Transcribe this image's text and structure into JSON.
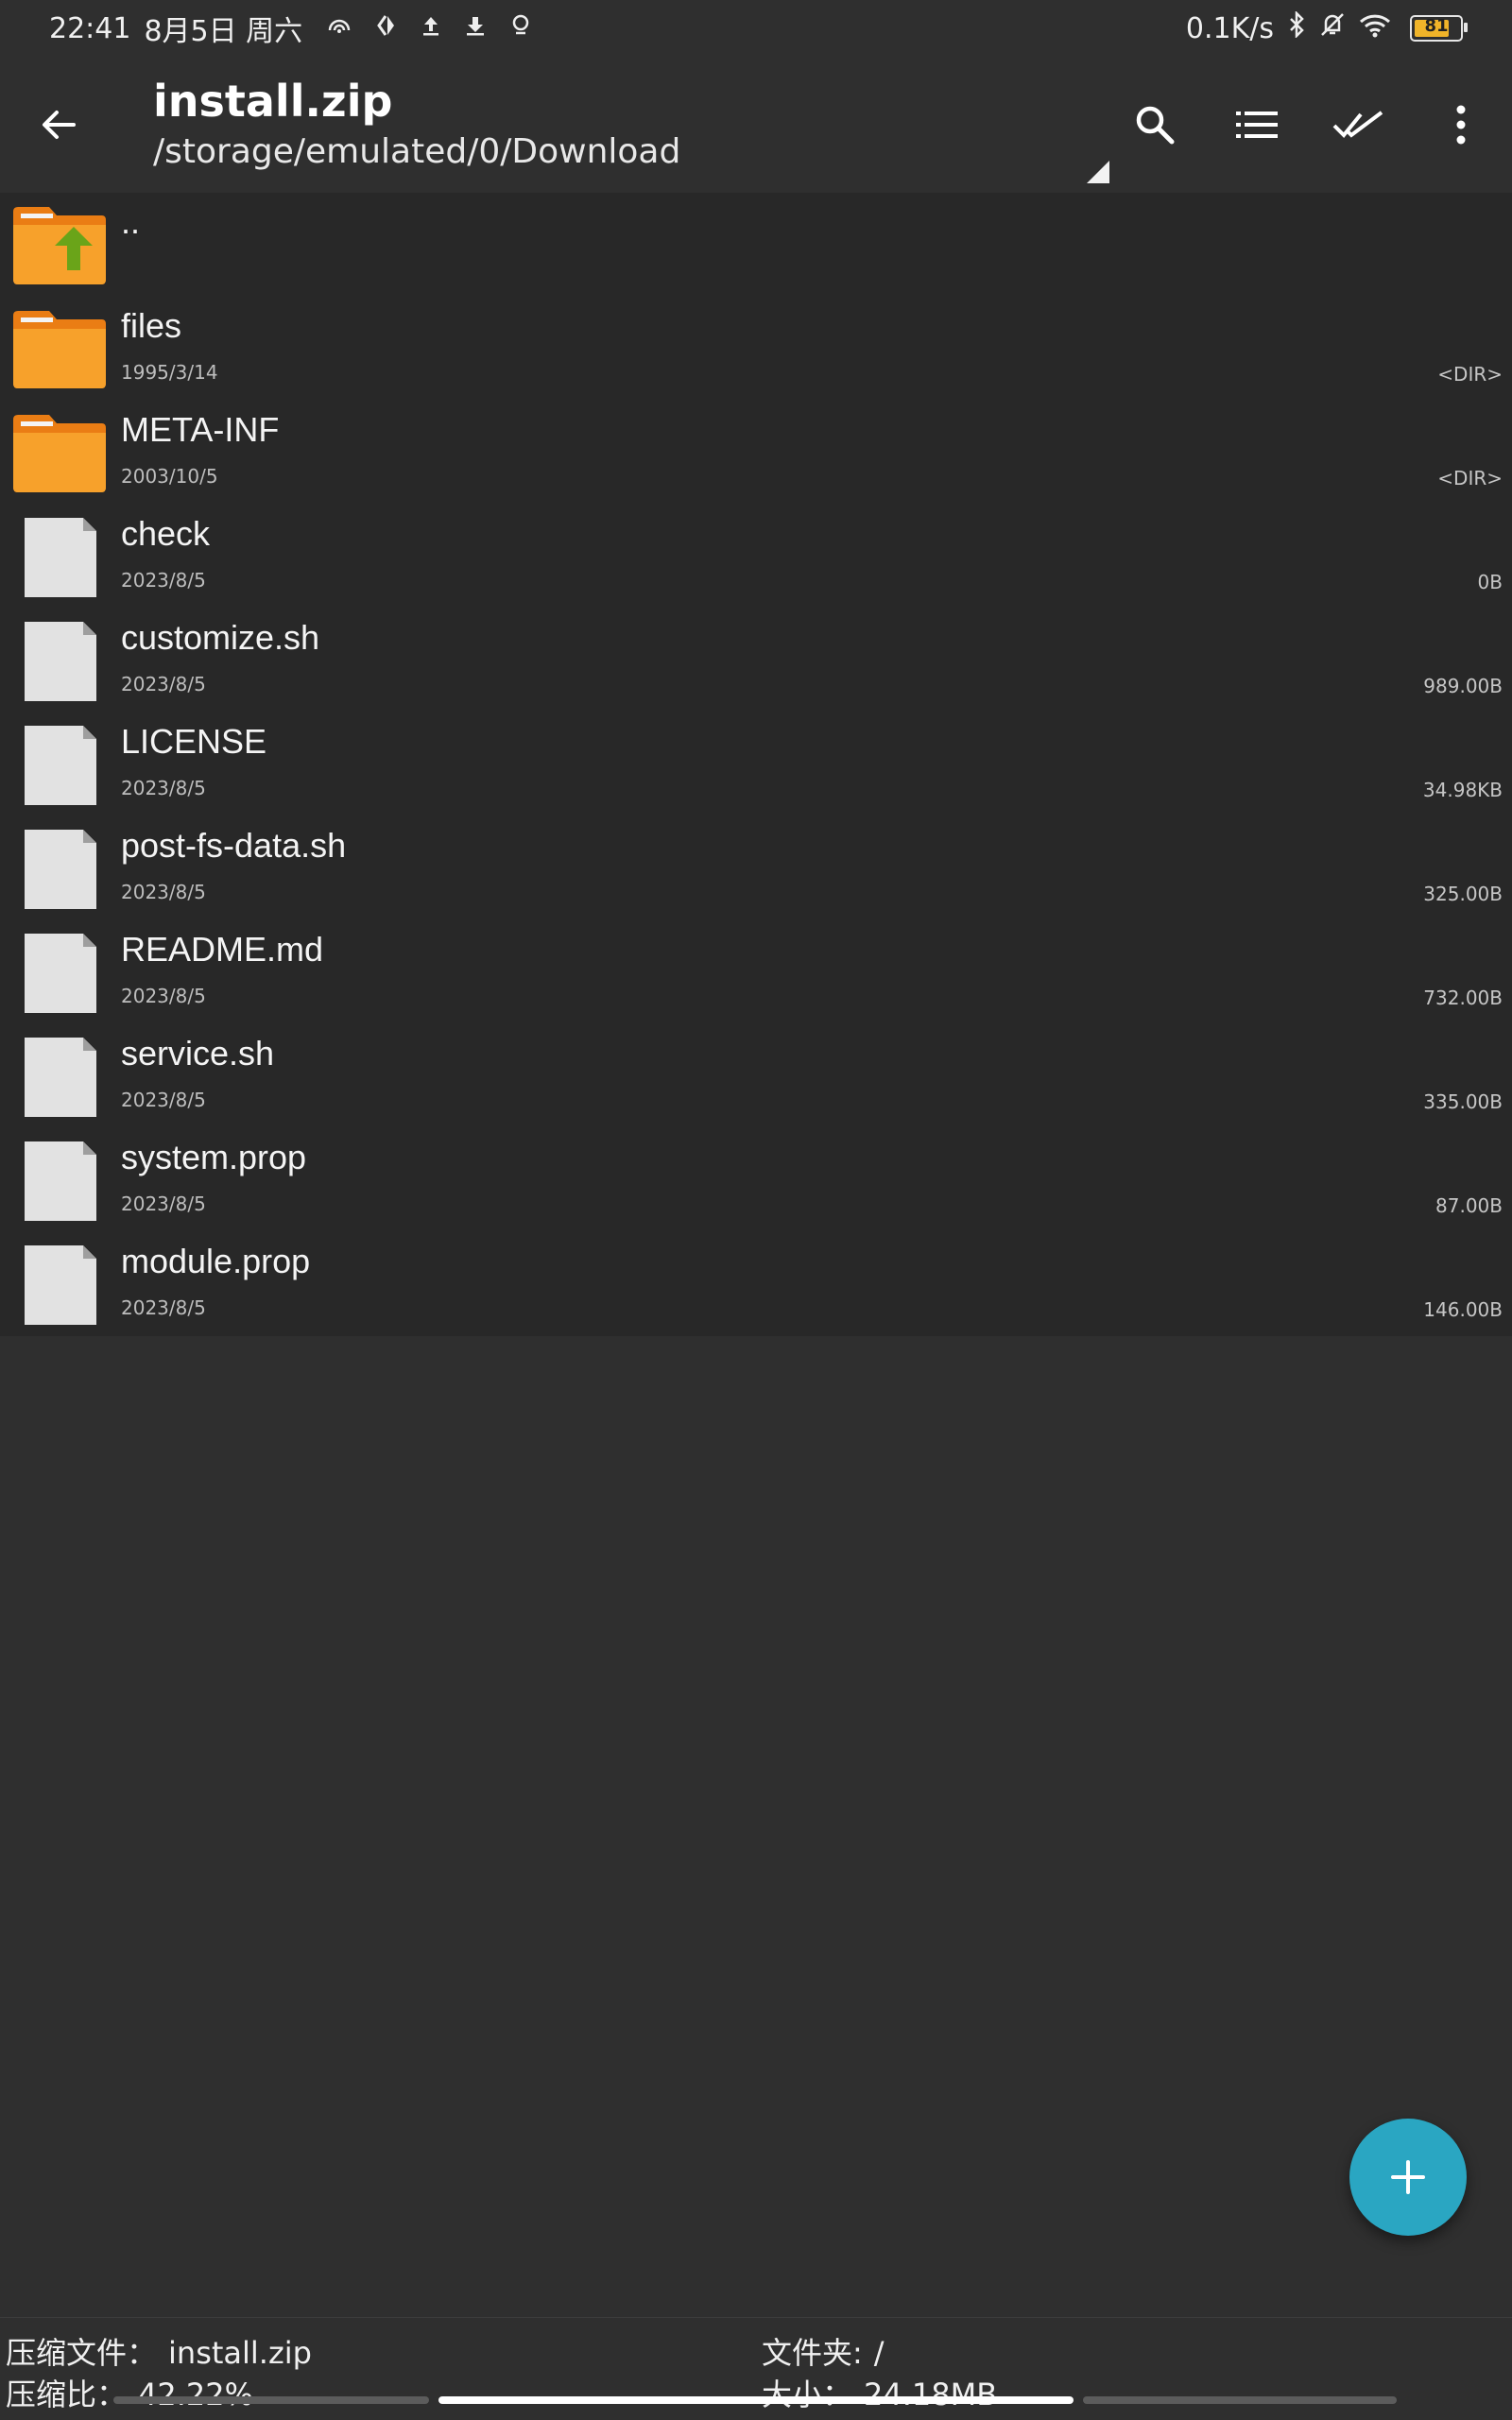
{
  "status_bar": {
    "time": "22:41",
    "date": "8月5日 周六",
    "net_speed": "0.1K/s",
    "battery_level": "81",
    "icons_left": [
      "hotspot-icon",
      "sync-icon",
      "upload-icon",
      "download-icon",
      "location-icon"
    ],
    "icons_right": [
      "bluetooth-icon",
      "mute-bell-icon",
      "wifi-icon",
      "battery-icon"
    ]
  },
  "app_bar": {
    "title": "install.zip",
    "path": "/storage/emulated/0/Download",
    "actions": [
      "search-icon",
      "list-view-icon",
      "select-all-icon",
      "more-vert-icon"
    ]
  },
  "files": [
    {
      "name": "..",
      "date": "",
      "size": "",
      "type": "parent"
    },
    {
      "name": "files",
      "date": "1995/3/14",
      "size": "<DIR>",
      "type": "folder"
    },
    {
      "name": "META-INF",
      "date": "2003/10/5",
      "size": "<DIR>",
      "type": "folder"
    },
    {
      "name": "check",
      "date": "2023/8/5",
      "size": "0B",
      "type": "file"
    },
    {
      "name": "customize.sh",
      "date": "2023/8/5",
      "size": "989.00B",
      "type": "file"
    },
    {
      "name": "LICENSE",
      "date": "2023/8/5",
      "size": "34.98KB",
      "type": "file"
    },
    {
      "name": "post-fs-data.sh",
      "date": "2023/8/5",
      "size": "325.00B",
      "type": "file"
    },
    {
      "name": "README.md",
      "date": "2023/8/5",
      "size": "732.00B",
      "type": "file"
    },
    {
      "name": "service.sh",
      "date": "2023/8/5",
      "size": "335.00B",
      "type": "file"
    },
    {
      "name": "system.prop",
      "date": "2023/8/5",
      "size": "87.00B",
      "type": "file"
    },
    {
      "name": "module.prop",
      "date": "2023/8/5",
      "size": "146.00B",
      "type": "file"
    }
  ],
  "fab": {
    "icon": "plus-icon"
  },
  "info_bar": {
    "archive_label": "压缩文件：",
    "archive_value": "install.zip",
    "ratio_label": "压缩比：",
    "ratio_value": "42.22%",
    "folder_label": "文件夹:",
    "folder_value": "/",
    "size_label": "大小：",
    "size_value": "24.18MB"
  },
  "colors": {
    "background": "#2f2f2f",
    "list_background": "#282828",
    "folder": "#f7a12b",
    "folder_tab": "#ea7d14",
    "up_arrow": "#6aa419",
    "fab": "#2aa6c2",
    "file_icon": "#e2e2e2"
  }
}
